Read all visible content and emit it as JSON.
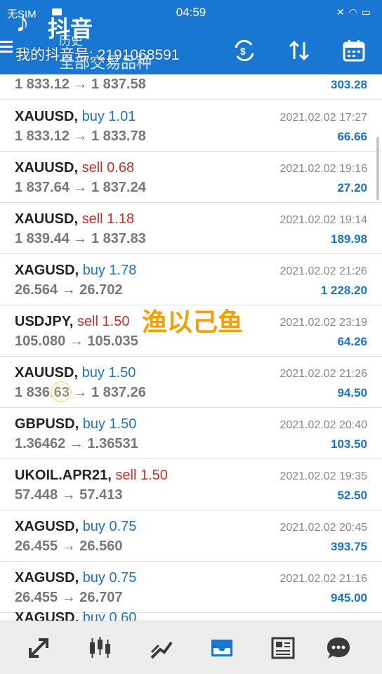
{
  "status_bar": {
    "carrier": "无SIM",
    "time": "04:59",
    "icons": [
      "camera-icon",
      "mute-icon",
      "wifi-icon",
      "battery-icon"
    ]
  },
  "overlay": {
    "app_name": "抖音",
    "account": "我的抖音号: 2191068591"
  },
  "toolbar": {
    "title": "历史",
    "subtitle": "全部交易品种",
    "actions": [
      "currency-exchange-icon",
      "sort-icon",
      "calendar-icon"
    ]
  },
  "partial_top_row": {
    "prices": "1 833.12 → 1 837.58",
    "profit": "303.28"
  },
  "trades": [
    {
      "symbol": "XAUUSD,",
      "side": "buy",
      "volume": "1.01",
      "prices": "1 833.12 → 1 833.78",
      "datetime": "2021.02.02 17:27",
      "profit": "66.66"
    },
    {
      "symbol": "XAUUSD,",
      "side": "sell",
      "volume": "0.68",
      "prices": "1 837.64 → 1 837.24",
      "datetime": "2021.02.02 19:16",
      "profit": "27.20"
    },
    {
      "symbol": "XAUUSD,",
      "side": "sell",
      "volume": "1.18",
      "prices": "1 839.44 → 1 837.83",
      "datetime": "2021.02.02 19:14",
      "profit": "189.98"
    },
    {
      "symbol": "XAGUSD,",
      "side": "buy",
      "volume": "1.78",
      "prices": "26.564 → 26.702",
      "datetime": "2021.02.02 21:26",
      "profit": "1 228.20"
    },
    {
      "symbol": "USDJPY,",
      "side": "sell",
      "volume": "1.50",
      "prices": "105.080 → 105.035",
      "datetime": "2021.02.02 23:19",
      "profit": "64.26"
    },
    {
      "symbol": "XAUUSD,",
      "side": "buy",
      "volume": "1.50",
      "prices": "1 836.63 → 1 837.26",
      "datetime": "2021.02.02 21:26",
      "profit": "94.50"
    },
    {
      "symbol": "GBPUSD,",
      "side": "buy",
      "volume": "1.50",
      "prices": "1.36462 → 1.36531",
      "datetime": "2021.02.02 20:40",
      "profit": "103.50"
    },
    {
      "symbol": "UKOIL.APR21,",
      "side": "sell",
      "volume": "1.50",
      "prices": "57.448 → 57.413",
      "datetime": "2021.02.02 19:35",
      "profit": "52.50"
    },
    {
      "symbol": "XAGUSD,",
      "side": "buy",
      "volume": "0.75",
      "prices": "26.455 → 26.560",
      "datetime": "2021.02.02 20:45",
      "profit": "393.75"
    },
    {
      "symbol": "XAGUSD,",
      "side": "buy",
      "volume": "0.75",
      "prices": "26.455 → 26.707",
      "datetime": "2021.02.02 21:16",
      "profit": "945.00"
    }
  ],
  "partial_bottom_row": {
    "symbol": "XAGUSD,",
    "side": "buy",
    "volume": "0.60"
  },
  "watermark": "渔以己鱼",
  "bottom_nav": [
    "quotes-icon",
    "chart-icon",
    "trade-icon",
    "history-icon",
    "news-icon",
    "chat-icon"
  ],
  "colors": {
    "toolbar": "#1976d2",
    "buy": "#1b73c6",
    "sell": "#c9302c",
    "active_nav": "#1976d2",
    "watermark": "#f5a000"
  }
}
